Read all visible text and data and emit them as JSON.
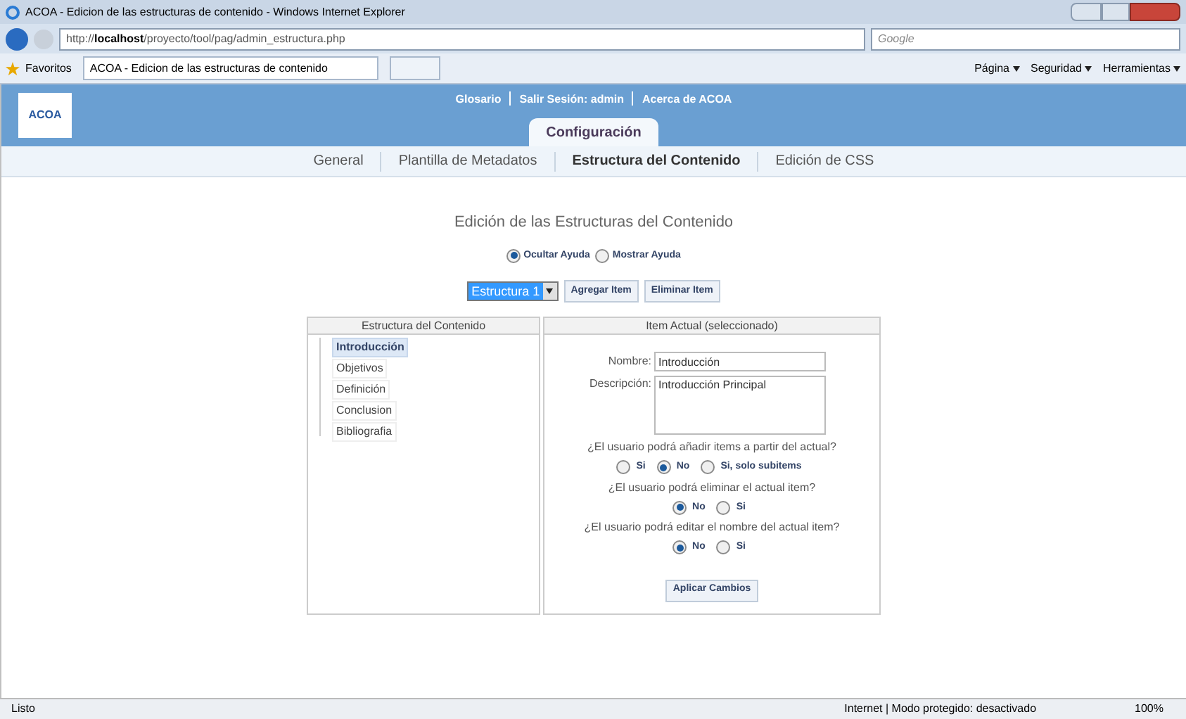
{
  "window": {
    "title": "ACOA - Edicion de las estructuras de contenido - Windows Internet Explorer"
  },
  "address_bar": {
    "url_prefix": "http://",
    "url_host": "localhost",
    "url_path": "/proyecto/tool/pag/admin_estructura.php",
    "search_placeholder": "Google"
  },
  "favorites_bar": {
    "favorites": "Favoritos",
    "tab": "ACOA - Edicion de las estructuras de contenido",
    "menus": [
      "Página",
      "Seguridad",
      "Herramientas"
    ]
  },
  "header": {
    "logo": "ACOA",
    "links": [
      "Glosario",
      "Salir Sesión: admin",
      "Acerca de ACOA"
    ],
    "tab": "Configuración"
  },
  "subnav": [
    {
      "label": "General",
      "selected": false
    },
    {
      "label": "Plantilla de Metadatos",
      "selected": false
    },
    {
      "label": "Estructura del Contenido",
      "selected": true
    },
    {
      "label": "Edición de CSS",
      "selected": false
    }
  ],
  "heading": "Edición de las Estructuras del Contenido",
  "help_options": [
    {
      "label": "Ocultar Ayuda",
      "selected": true
    },
    {
      "label": "Mostrar Ayuda",
      "selected": false
    }
  ],
  "structure_select": "Estructura 1",
  "buttons": [
    "Agregar Item",
    "Eliminar Item"
  ],
  "tree": {
    "title": "Estructura del Contenido",
    "items": [
      {
        "label": "Introducción",
        "selected": true
      },
      {
        "label": "Objetivos",
        "selected": false
      },
      {
        "label": "Definición",
        "selected": false
      },
      {
        "label": "Conclusion",
        "selected": false
      },
      {
        "label": "Bibliografia",
        "selected": false
      }
    ]
  },
  "item_panel": {
    "title": "Item Actual (seleccionado)",
    "name_label": "Nombre:",
    "name_value": "Introducción",
    "description_label": "Descripción:",
    "description_value": "Introducción Principal",
    "questions": [
      {
        "text": "¿El usuario podrá añadir items a partir del actual?",
        "options": [
          {
            "label": "Si",
            "selected": false
          },
          {
            "label": "No",
            "selected": true
          },
          {
            "label": "Si, solo subitems",
            "selected": false
          }
        ]
      },
      {
        "text": "¿El usuario podrá eliminar el actual item?",
        "options": [
          {
            "label": "No",
            "selected": true
          },
          {
            "label": "Si",
            "selected": false
          }
        ]
      },
      {
        "text": "¿El usuario podrá editar el nombre del actual item?",
        "options": [
          {
            "label": "No",
            "selected": true
          },
          {
            "label": "Si",
            "selected": false
          }
        ]
      }
    ],
    "apply_button": "Aplicar Cambios"
  },
  "status_bar": {
    "status": "Listo",
    "zone": "Internet | Modo protegido: desactivado",
    "zoom": "100%"
  }
}
